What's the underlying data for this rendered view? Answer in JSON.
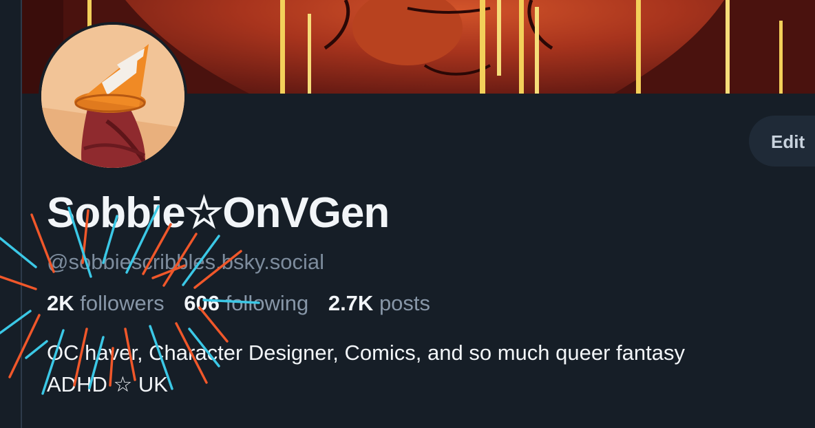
{
  "profile": {
    "display_name": "Sobbie☆OnVGen",
    "handle": "@sobbiescribbles.bsky.social",
    "edit_label": "Edit",
    "stats": {
      "followers_count": "2K",
      "followers_label": "followers",
      "following_count": "606",
      "following_label": "following",
      "posts_count": "2.7K",
      "posts_label": "posts"
    },
    "bio": {
      "line1": "OC haver, Character Designer, Comics, and so much queer fantasy",
      "line2": "ADHD ☆ UK"
    }
  },
  "colors": {
    "background": "#161e27",
    "accent_orange": "#f0572a",
    "accent_cyan": "#3bc8e6",
    "text_primary": "#f2f5f8",
    "text_muted": "#7d8c9d"
  }
}
